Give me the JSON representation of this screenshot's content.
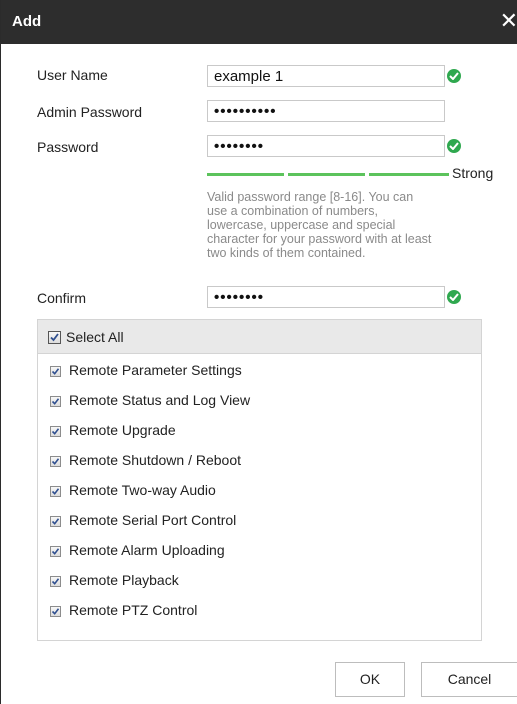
{
  "dialog": {
    "title": "Add",
    "close_icon": "close-icon"
  },
  "form": {
    "user_name": {
      "label": "User Name",
      "value": "example 1",
      "valid": true
    },
    "admin_password": {
      "label": "Admin Password",
      "value": "••••••••••"
    },
    "password": {
      "label": "Password",
      "value": "••••••••",
      "valid": true,
      "strength_label": "Strong",
      "strength_level": 3,
      "strength_max": 3
    },
    "password_hint": "Valid password range [8-16]. You can use a combination of numbers, lowercase, uppercase and special character for your password with at least two kinds of them contained.",
    "confirm": {
      "label": "Confirm",
      "value": "••••••••",
      "valid": true
    }
  },
  "permissions": {
    "select_all": {
      "label": "Select All",
      "checked": true
    },
    "items": [
      {
        "label": "Remote Parameter Settings",
        "checked": true
      },
      {
        "label": "Remote Status and Log View",
        "checked": true
      },
      {
        "label": "Remote Upgrade",
        "checked": true
      },
      {
        "label": "Remote Shutdown / Reboot",
        "checked": true
      },
      {
        "label": "Remote Two-way Audio",
        "checked": true
      },
      {
        "label": "Remote Serial Port Control",
        "checked": true
      },
      {
        "label": "Remote Alarm Uploading",
        "checked": true
      },
      {
        "label": "Remote Playback",
        "checked": true
      },
      {
        "label": "Remote PTZ Control",
        "checked": true
      }
    ]
  },
  "buttons": {
    "ok": "OK",
    "cancel": "Cancel"
  },
  "colors": {
    "titlebar": "#2d2d2d",
    "valid": "#2fa84f",
    "strength": "#5cc35c"
  }
}
